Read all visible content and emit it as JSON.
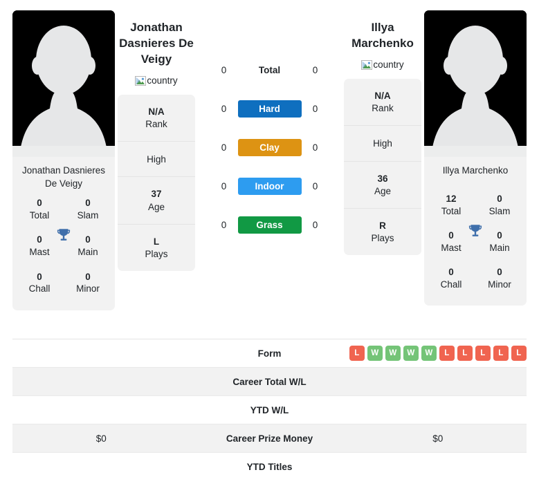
{
  "players": {
    "left": {
      "name": "Jonathan Dasnieres De Veigy",
      "card_name": "Jonathan Dasnieres De Veigy",
      "country_alt": "country",
      "titles": [
        {
          "value": "0",
          "label": "Total"
        },
        {
          "value": "0",
          "label": "Slam"
        },
        {
          "value": "0",
          "label": "Mast"
        },
        {
          "value": "0",
          "label": "Main"
        },
        {
          "value": "0",
          "label": "Chall"
        },
        {
          "value": "0",
          "label": "Minor"
        }
      ],
      "info": [
        {
          "value": "N/A",
          "label": "Rank"
        },
        {
          "value": "",
          "label": "High"
        },
        {
          "value": "37",
          "label": "Age"
        },
        {
          "value": "L",
          "label": "Plays"
        }
      ],
      "prize_money": "$0",
      "career_total_wl": "",
      "ytd_wl": "",
      "ytd_titles": ""
    },
    "right": {
      "name": "Illya Marchenko",
      "card_name": "Illya Marchenko",
      "country_alt": "country",
      "titles": [
        {
          "value": "12",
          "label": "Total"
        },
        {
          "value": "0",
          "label": "Slam"
        },
        {
          "value": "0",
          "label": "Mast"
        },
        {
          "value": "0",
          "label": "Main"
        },
        {
          "value": "0",
          "label": "Chall"
        },
        {
          "value": "0",
          "label": "Minor"
        }
      ],
      "info": [
        {
          "value": "N/A",
          "label": "Rank"
        },
        {
          "value": "",
          "label": "High"
        },
        {
          "value": "36",
          "label": "Age"
        },
        {
          "value": "R",
          "label": "Plays"
        }
      ],
      "prize_money": "$0",
      "career_total_wl": "",
      "ytd_wl": "",
      "ytd_titles": ""
    }
  },
  "surfaces": [
    {
      "label": "Total",
      "left": "0",
      "right": "0",
      "color": "transparent",
      "plain": true
    },
    {
      "label": "Hard",
      "left": "0",
      "right": "0",
      "color": "#0f6fbf",
      "plain": false
    },
    {
      "label": "Clay",
      "left": "0",
      "right": "0",
      "color": "#dd9313",
      "plain": false
    },
    {
      "label": "Indoor",
      "left": "0",
      "right": "0",
      "color": "#2d9cf0",
      "plain": false
    },
    {
      "label": "Grass",
      "left": "0",
      "right": "0",
      "color": "#119944",
      "plain": false
    }
  ],
  "table": {
    "rows": [
      {
        "label": "Form",
        "left": "",
        "right": "",
        "type": "form"
      },
      {
        "label": "Career Total W/L",
        "left": "",
        "right": "",
        "type": "text"
      },
      {
        "label": "YTD W/L",
        "left": "",
        "right": "",
        "type": "text"
      },
      {
        "label": "Career Prize Money",
        "left": "$0",
        "right": "$0",
        "type": "text"
      },
      {
        "label": "YTD Titles",
        "left": "",
        "right": "",
        "type": "text"
      }
    ],
    "form_right": [
      "L",
      "W",
      "W",
      "W",
      "W",
      "L",
      "L",
      "L",
      "L",
      "L"
    ]
  },
  "colors": {
    "hard": "#0f6fbf",
    "clay": "#dd9313",
    "indoor": "#2d9cf0",
    "grass": "#119944",
    "win": "#74c477",
    "loss": "#f06450",
    "card_bg": "#f2f2f2",
    "trophy": "#3f6fab"
  }
}
